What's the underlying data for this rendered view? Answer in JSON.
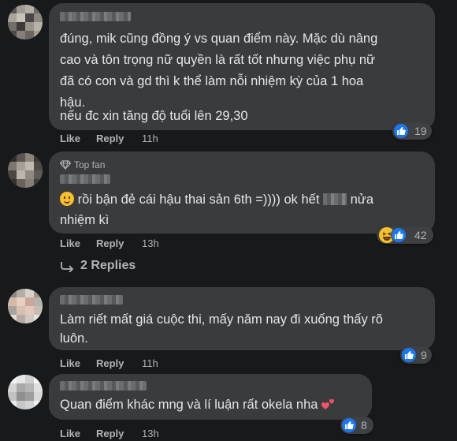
{
  "comments": [
    {
      "text_lines": [
        "đúng, mik cũng đồng ý vs quan điểm này. Mặc dù nâng",
        "cao và tôn trọng nữ quyền là rất tốt nhưng việc phụ nữ",
        "đã có con và gd thì k thể làm nỗi nhiệm kỳ của 1 hoa",
        "hậu.",
        "nếu đc xin tăng độ tuổi lên 29,30"
      ],
      "like_label": "Like",
      "reply_label": "Reply",
      "time": "11h",
      "reaction_count": "19"
    },
    {
      "badge": "Top fan",
      "text_line1_a": "rồi bận đẻ cái hậu thai sản 6th =)))) ok hết",
      "text_line1_b": "nửa",
      "text_line2": "nhiệm kì",
      "like_label": "Like",
      "reply_label": "Reply",
      "time": "13h",
      "reaction_count": "42",
      "replies_label": "2 Replies"
    },
    {
      "text_lines": [
        "Làm riết mất giá cuộc thi, mấy năm nay đi xuống thấy rõ",
        "luôn."
      ],
      "like_label": "Like",
      "reply_label": "Reply",
      "time": "11h",
      "reaction_count": "9"
    },
    {
      "text": "Quan điểm khác mng và lí luận rất okela nha",
      "like_label": "Like",
      "reply_label": "Reply",
      "time": "13h",
      "reaction_count": "8"
    }
  ],
  "colors": {
    "background": "#18191a",
    "bubble": "#3a3b3c",
    "like_blue": "#1877f2",
    "text": "#e4e6eb",
    "muted": "#b0b3b8"
  }
}
